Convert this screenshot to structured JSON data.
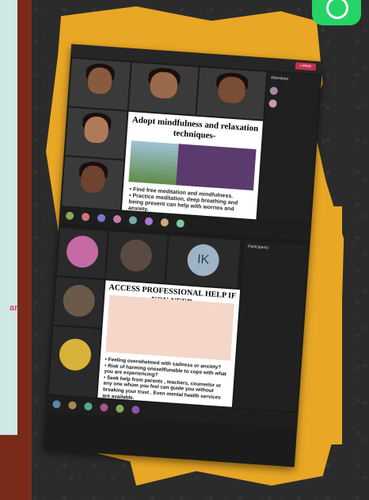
{
  "left_panel": {
    "pink_text": "ar"
  },
  "call1": {
    "top_bar": {
      "leave_label": "Leave"
    },
    "tiles": [
      {
        "name": ""
      },
      {
        "name": ""
      },
      {
        "name": ""
      },
      {
        "name": ""
      },
      {
        "name": ""
      }
    ],
    "slide": {
      "title": "Adopt mindfulness and relaxation techniques-",
      "bullets": [
        "• Find free meditation and mindfulness.",
        "• Practice meditation, deep breathing and being present can help with worries and anxiety."
      ]
    },
    "side_panel": {
      "title": "Attendees"
    }
  },
  "call2": {
    "avatar_initials": "IK",
    "side_panel": {
      "title": "Participants"
    },
    "slide": {
      "title": "ACCESS PROFESSIONAL HELP IF YOU NEED",
      "bullets": [
        "• Feeling overwhelmed with sadness or anxiety?",
        "• Risk of harming oneself/unable to cope with what you are experiencing?",
        "• Seek help from parents , teachers, counselor or any one whom you feel can guide you without breaking your trust . Even mental health services are available."
      ]
    }
  },
  "colors": {
    "paper": "#e8a725",
    "leave": "#c4314b",
    "whatsapp": "#25d366"
  }
}
